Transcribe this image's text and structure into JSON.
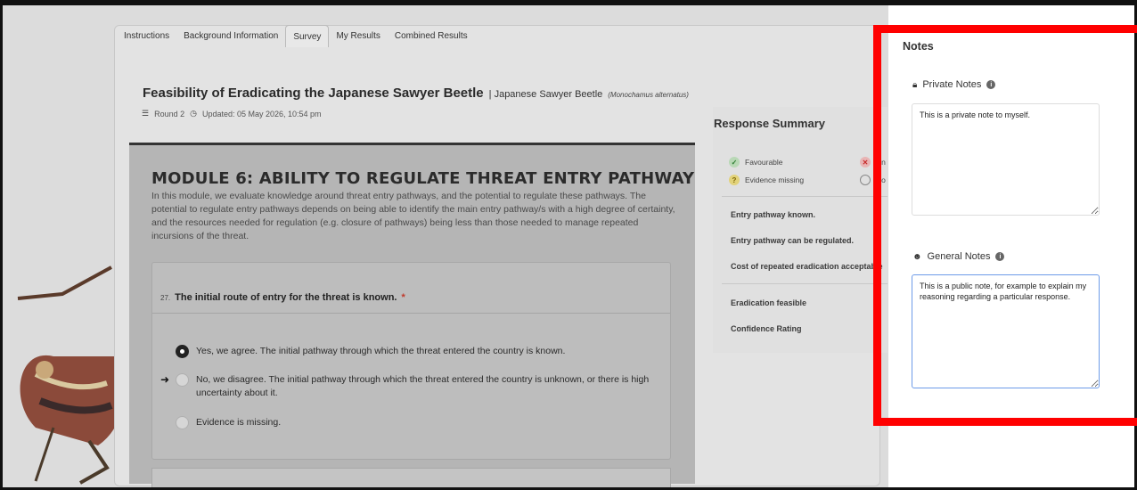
{
  "tabs": [
    {
      "label": "Instructions"
    },
    {
      "label": "Background Information"
    },
    {
      "label": "Survey"
    },
    {
      "label": "My Results"
    },
    {
      "label": "Combined Results"
    }
  ],
  "active_tab": "Survey",
  "header": {
    "title": "Feasibility of Eradicating the Japanese Sawyer Beetle",
    "subtitle": "| Japanese Sawyer Beetle",
    "scientific_name": "(Monochamus alternatus)",
    "round": "Round 2",
    "updated": "Updated: 05 May 2026, 10:54 pm"
  },
  "module": {
    "title": "MODULE 6: ABILITY TO REGULATE THREAT ENTRY PATHWAY",
    "description": "In this module, we evaluate knowledge around threat entry pathways, and the potential to regulate these pathways. The potential to regulate entry pathways depends on being able to identify the main entry pathway/s with a high degree of certainty, and the resources needed for regulation (e.g. closure of pathways) being less than those needed to manage repeated incursions of the threat."
  },
  "question": {
    "number": "27.",
    "text": "The initial route of entry for the threat is known.",
    "required_mark": "*",
    "options": [
      {
        "label": "Yes, we agree. The initial pathway through which the threat entered the country is known.",
        "selected": true
      },
      {
        "label": "No, we disagree. The initial pathway through which the threat entered the country is unknown, or there is high uncertainty about it.",
        "selected": false
      },
      {
        "label": "Evidence is missing.",
        "selected": false
      }
    ]
  },
  "summary": {
    "title": "Response Summary",
    "legend": {
      "favourable": "Favourable",
      "unfavourable_partial": "Un",
      "evidence_missing": "Evidence missing",
      "no_partial": "No"
    },
    "items": [
      "Entry pathway known.",
      "Entry pathway can be regulated.",
      "Cost of repeated eradication acceptable"
    ],
    "results": [
      "Eradication feasible",
      "Confidence Rating"
    ]
  },
  "notes": {
    "title": "Notes",
    "private_label": "Private Notes",
    "private_value": "This is a private note to myself.",
    "general_label": "General Notes",
    "general_value": "This is a public note, for example to explain my reasoning regarding a particular response."
  },
  "colors": {
    "annotation_box": "#ff0000",
    "focus_border": "#6d9be8",
    "required": "#c0392b"
  }
}
